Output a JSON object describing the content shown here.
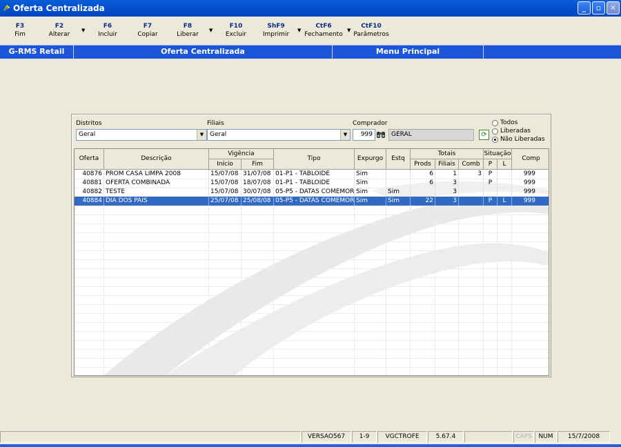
{
  "window": {
    "title": "Oferta Centralizada",
    "buttons": {
      "minimize": "_",
      "maximize": "▫",
      "close": "✕"
    }
  },
  "toolbar": [
    {
      "key": "F3",
      "label": "Fim"
    },
    {
      "key": "F2",
      "label": "Alterar"
    },
    {
      "key": "F6",
      "label": "Incluir"
    },
    {
      "key": "F7",
      "label": "Copiar"
    },
    {
      "key": "F8",
      "label": "Liberar"
    },
    {
      "key": "F10",
      "label": "Excluir"
    },
    {
      "key": "ShF9",
      "label": "Imprimir"
    },
    {
      "key": "CtF6",
      "label": "Fechamento"
    },
    {
      "key": "CtF10",
      "label": "Parâmetros"
    }
  ],
  "navbar": {
    "app": "G-RMS Retail",
    "screen": "Oferta Centralizada",
    "menu": "Menu Principal"
  },
  "filters": {
    "districts_label": "Distritos",
    "districts_value": "Geral",
    "branches_label": "Filiais",
    "branches_value": "Geral",
    "buyer_label": "Comprador",
    "buyer_code": "999",
    "buyer_name": "GERAL",
    "status_options": [
      {
        "label": "Todos",
        "selected": false
      },
      {
        "label": "Liberadas",
        "selected": false
      },
      {
        "label": "Não Liberadas",
        "selected": true
      }
    ]
  },
  "table": {
    "headers": {
      "oferta": "Oferta",
      "descricao": "Descrição",
      "vigencia": "Vigência",
      "inicio": "Início",
      "fim": "Fim",
      "tipo": "Tipo",
      "expurgo": "Expurgo",
      "estq": "Estq",
      "totais": "Totais",
      "prods": "Prods",
      "filiais": "Filiais",
      "comb": "Comb",
      "situacao": "Situação",
      "p": "P",
      "l": "L",
      "comp": "Comp"
    },
    "rows": [
      {
        "oferta": "40876",
        "descricao": "PROM CASA LIMPA 2008",
        "inicio": "15/07/08",
        "fim": "31/07/08",
        "tipo": "01-P1 - TABLOIDE",
        "expurgo": "Sim",
        "estq": "",
        "prods": "6",
        "filiais": "1",
        "comb": "3",
        "p": "P",
        "l": "",
        "comp": "999",
        "selected": false
      },
      {
        "oferta": "40881",
        "descricao": "OFERTA COMBINADA",
        "inicio": "15/07/08",
        "fim": "18/07/08",
        "tipo": "01-P1 - TABLOIDE",
        "expurgo": "Sim",
        "estq": "",
        "prods": "6",
        "filiais": "3",
        "comb": "",
        "p": "P",
        "l": "",
        "comp": "999",
        "selected": false
      },
      {
        "oferta": "40882",
        "descricao": "TESTE",
        "inicio": "15/07/08",
        "fim": "30/07/08",
        "tipo": "05-P5 - DATAS COMEMOR",
        "expurgo": "Sim",
        "estq": "Sim",
        "prods": "",
        "filiais": "3",
        "comb": "",
        "p": "",
        "l": "",
        "comp": "999",
        "selected": false
      },
      {
        "oferta": "40884",
        "descricao": "DIA DOS PAIS",
        "inicio": "25/07/08",
        "fim": "25/08/08",
        "tipo": "05-P5 - DATAS COMEMOR",
        "expurgo": "Sim",
        "estq": "Sim",
        "prods": "22",
        "filiais": "3",
        "comb": "",
        "p": "P",
        "l": "L",
        "comp": "999",
        "selected": true
      }
    ]
  },
  "statusbar": {
    "version": "VERSAO567",
    "range": "1-9",
    "program": "VGCTROFE",
    "build": "5.67.4",
    "caps": "CAPS",
    "num": "NUM",
    "date": "15/7/2008"
  },
  "colors": {
    "title_blue": "#0550d0",
    "nav_blue": "#1d55d8",
    "selection": "#316ac5",
    "window_bg": "#ece9d8"
  }
}
